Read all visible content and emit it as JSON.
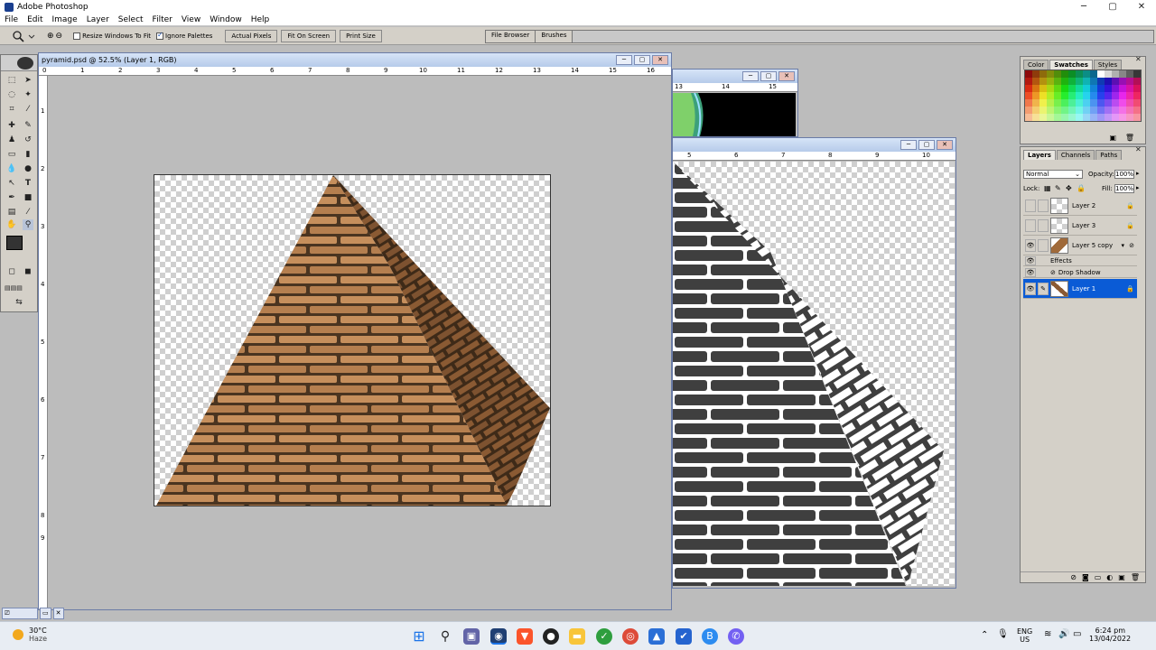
{
  "window": {
    "title": "Adobe Photoshop",
    "controls": [
      "─",
      "▢",
      "✕"
    ]
  },
  "menu": [
    "File",
    "Edit",
    "Image",
    "Layer",
    "Select",
    "Filter",
    "View",
    "Window",
    "Help"
  ],
  "options_bar": {
    "tool_icon": "zoom-icon",
    "resize_windows_label": "Resize Windows To Fit",
    "resize_windows_checked": false,
    "ignore_palettes_label": "Ignore Palettes",
    "ignore_palettes_checked": true,
    "actual_pixels": "Actual Pixels",
    "fit_on_screen": "Fit On Screen",
    "print_size": "Print Size",
    "palette_well_tabs": [
      "File Browser",
      "Brushes"
    ]
  },
  "document_main": {
    "title": "pyramid.psd @ 52.5% (Layer 1, RGB)",
    "ruler_h_ticks": [
      "0",
      "1",
      "2",
      "3",
      "4",
      "5",
      "6",
      "7",
      "8",
      "9",
      "10",
      "11",
      "12",
      "13",
      "14",
      "15",
      "16"
    ],
    "ruler_v_ticks": [
      "1",
      "2",
      "3",
      "4",
      "5",
      "6",
      "7",
      "8",
      "9"
    ]
  },
  "document_back": {
    "ruler_h_ticks": [
      "13",
      "14",
      "15"
    ]
  },
  "document_front": {
    "ruler_h_ticks": [
      "5",
      "6",
      "7",
      "8",
      "9",
      "10"
    ]
  },
  "swatches_panel": {
    "tabs": [
      "Color",
      "Swatches",
      "Styles"
    ],
    "active_tab": "Swatches"
  },
  "layers_panel": {
    "tabs": [
      "Layers",
      "Channels",
      "Paths"
    ],
    "active_tab": "Layers",
    "blend_mode": "Normal",
    "opacity_label": "Opacity:",
    "opacity_value": "100%",
    "lock_label": "Lock:",
    "fill_label": "Fill:",
    "fill_value": "100%",
    "layers": [
      {
        "name": "Layer 2",
        "visible": false,
        "selected": false
      },
      {
        "name": "Layer 3",
        "visible": false,
        "selected": false
      },
      {
        "name": "Layer 5 copy",
        "visible": true,
        "selected": false
      },
      {
        "name": "Effects",
        "visible": true,
        "selected": false
      },
      {
        "name": "Drop Shadow",
        "visible": true,
        "selected": false
      },
      {
        "name": "Layer 1",
        "visible": true,
        "selected": true
      }
    ]
  },
  "colors": {
    "accent": "#0a5bd6",
    "brick_light": "#c68f5c",
    "brick_dark": "#8a5a33",
    "mortar": "#4a3420",
    "foreground": "#333333",
    "background": "#c79a6b"
  },
  "taskbar": {
    "weather_temp": "30°C",
    "weather_desc": "Haze",
    "lang": "ENG",
    "region": "US",
    "time": "6:24 pm",
    "date": "13/04/2022"
  }
}
